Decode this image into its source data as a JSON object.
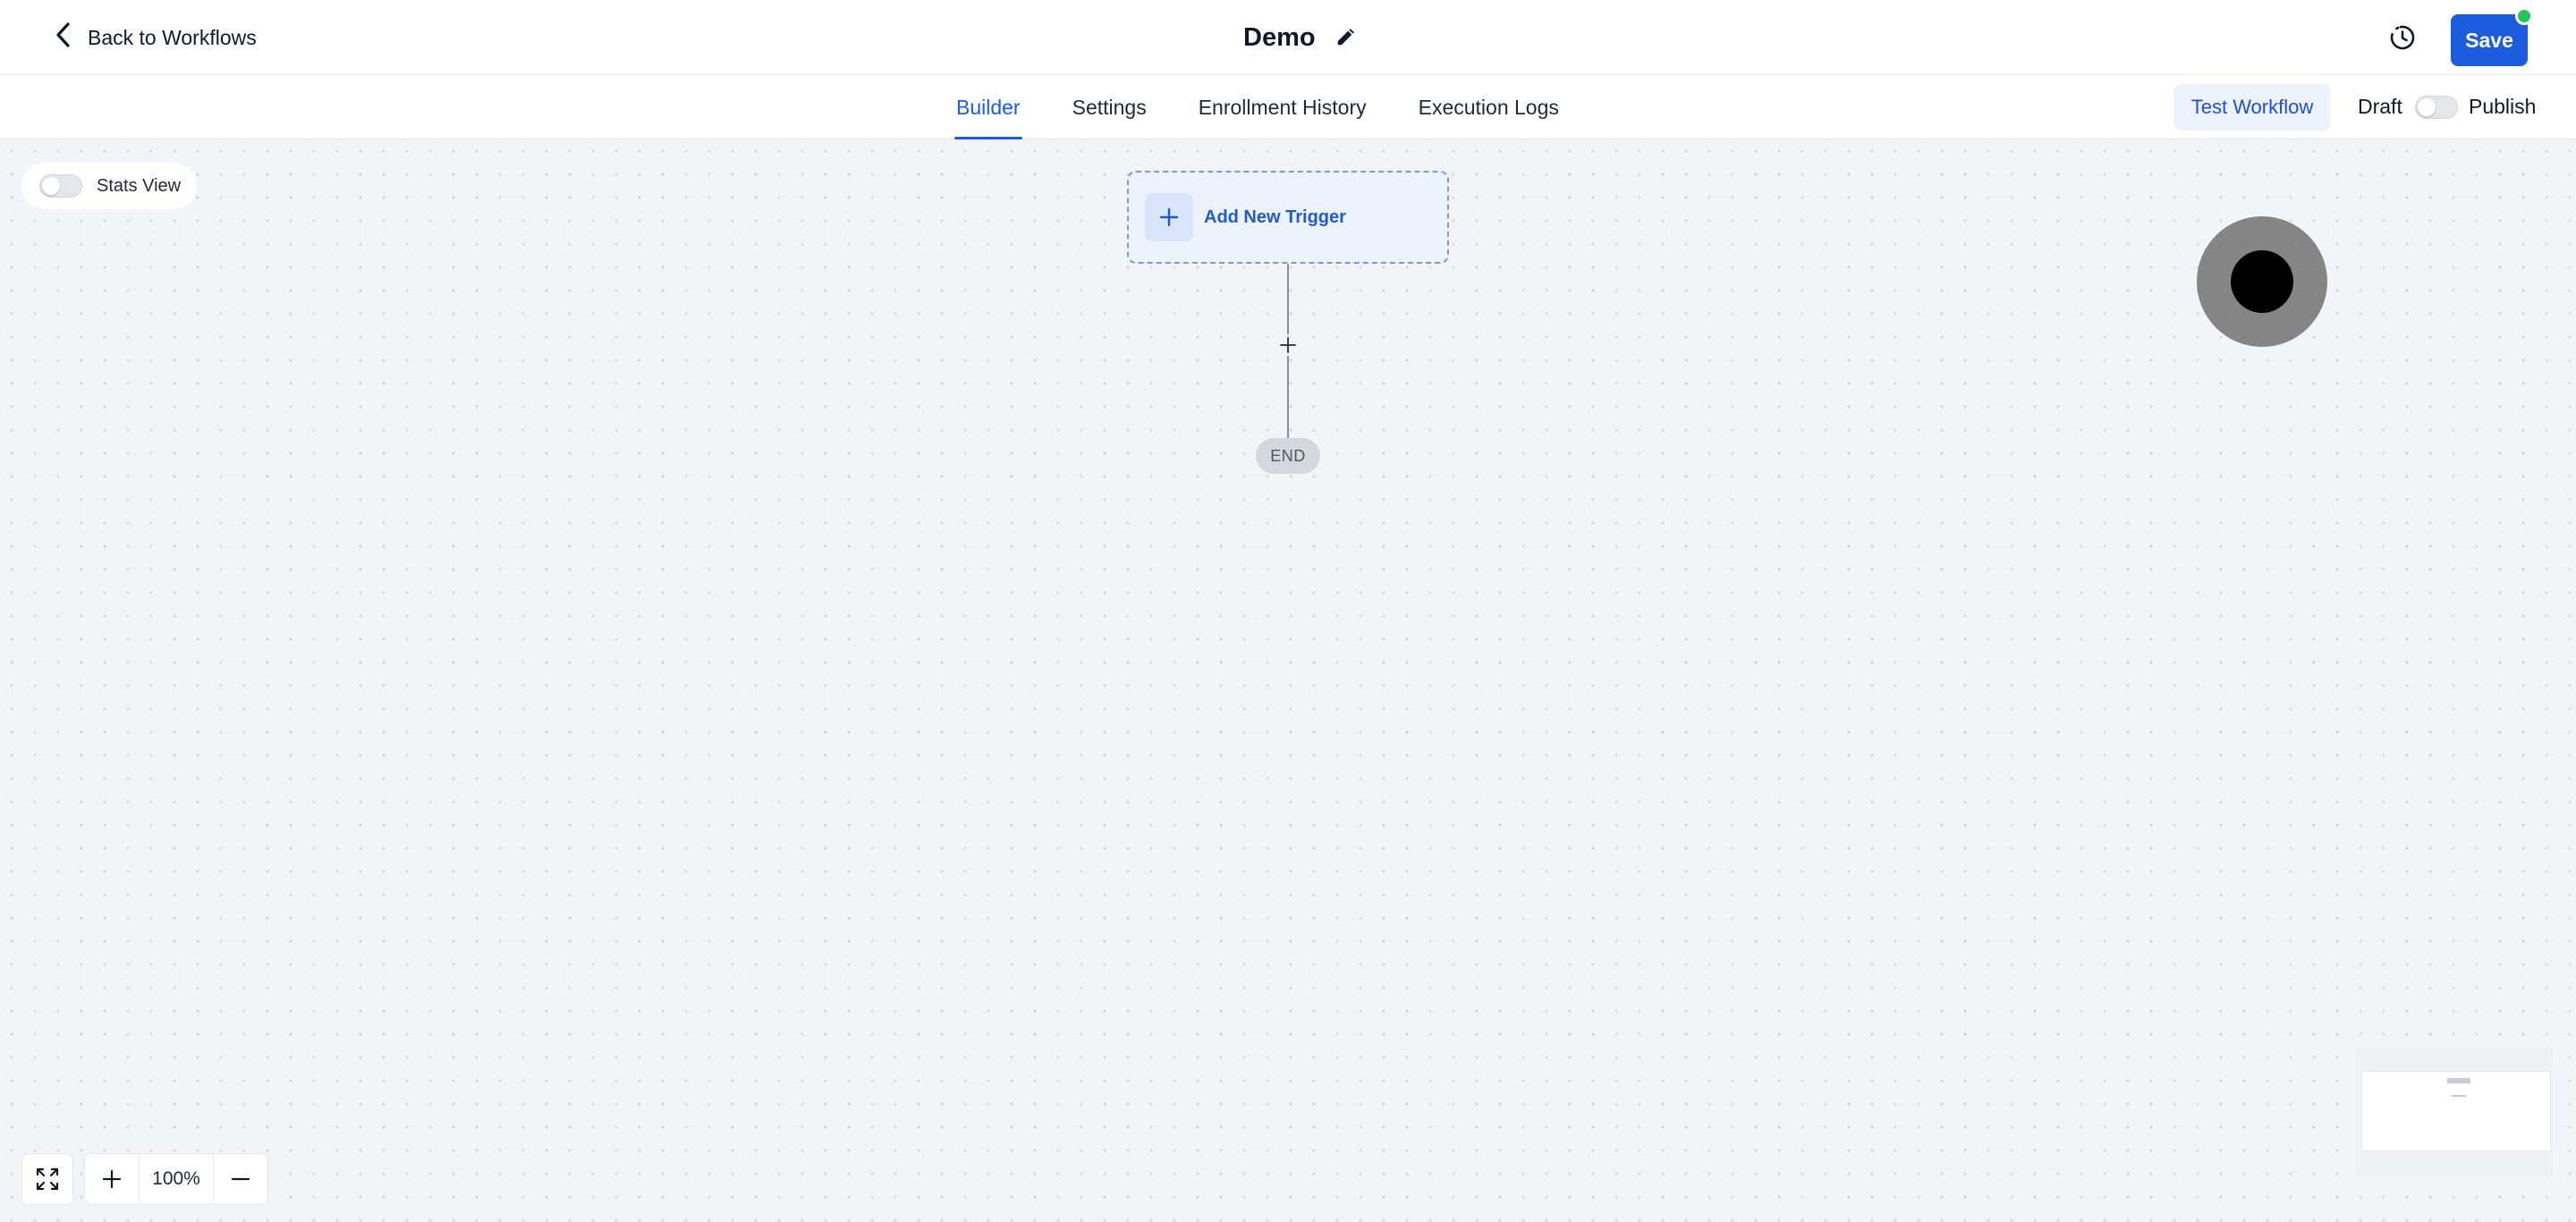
{
  "header": {
    "back_label": "Back to Workflows",
    "title": "Demo",
    "save_label": "Save",
    "status_color": "#22c55e"
  },
  "tabs": [
    {
      "label": "Builder",
      "active": true
    },
    {
      "label": "Settings",
      "active": false
    },
    {
      "label": "Enrollment History",
      "active": false
    },
    {
      "label": "Execution Logs",
      "active": false
    }
  ],
  "actions": {
    "test_workflow_label": "Test Workflow",
    "draft_label": "Draft",
    "publish_label": "Publish",
    "published": false
  },
  "canvas": {
    "stats_view_label": "Stats View",
    "stats_view_on": false,
    "trigger_label": "Add New Trigger",
    "end_label": "END"
  },
  "zoom": {
    "level": "100%"
  },
  "colors": {
    "accent": "#1c5ddf",
    "canvas_bg": "#f3f4f7"
  },
  "icons": {
    "back": "chevron-left-icon",
    "edit": "pencil-icon",
    "history": "clock-history-icon",
    "trigger_add": "plus-icon",
    "add_step": "plus-icon",
    "fit": "expand-arrows-icon",
    "zoom_in": "plus-icon",
    "zoom_out": "minus-icon"
  }
}
